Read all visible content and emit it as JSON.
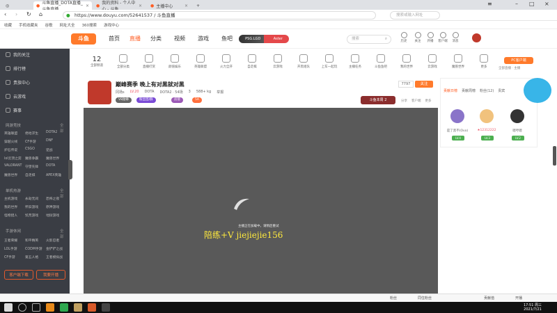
{
  "browser": {
    "tabs": [
      {
        "title": "斗鱼直播_DOTA直播_斗鱼直播",
        "active": true
      },
      {
        "title": "我的资料 - 个人中心 - 斗鱼"
      },
      {
        "title": "主播中心"
      }
    ],
    "url": "https://www.douyu.com/52641537 / 斗鱼直播",
    "url_display": "https://www.douyu.com/52641537 / 斗鱼直播",
    "search_placeholder": "搜索或输入网址",
    "bookmarks": [
      "收藏",
      "手机收藏夹",
      "谷歌",
      "网址大全",
      "360搜索",
      "游戏中心"
    ]
  },
  "header": {
    "logo": "斗鱼",
    "nav": [
      {
        "label": "首页",
        "active": false
      },
      {
        "label": "直播",
        "active": true
      },
      {
        "label": "分类",
        "active": false
      },
      {
        "label": "视频",
        "active": false
      },
      {
        "label": "游戏",
        "active": false
      },
      {
        "label": "鱼吧",
        "active": false
      }
    ],
    "promo_name": "PSG.LGD",
    "promo_vs": "Aster",
    "search_placeholder": "搜索",
    "icons": [
      {
        "label": "历史",
        "icon": "history-icon"
      },
      {
        "label": "关注",
        "icon": "follow-icon"
      },
      {
        "label": "开播",
        "icon": "broadcast-icon"
      },
      {
        "label": "客户端",
        "icon": "client-icon"
      },
      {
        "label": "消息",
        "icon": "message-icon"
      }
    ]
  },
  "sidebar": {
    "items": [
      {
        "label": "我的关注"
      },
      {
        "label": "排行榜"
      },
      {
        "label": "贵族中心"
      },
      {
        "label": "云游戏"
      },
      {
        "label": "赛事"
      }
    ],
    "sections": [
      {
        "title": "网游竞技",
        "more": "全部",
        "games": [
          "英雄联盟",
          "绝地求生",
          "DOTA2",
          "穿越火线",
          "CF手游",
          "DNF",
          "炉石传说",
          "CSGO",
          "逆战",
          "lol云顶之弈",
          "魔兽争霸",
          "魔兽世界",
          "VALORANT",
          "守望先锋",
          "DOTA",
          "魔兽世界",
          "自走棋",
          "APEX英雄"
        ]
      },
      {
        "title": "单机热游",
        "more": "全部",
        "games": [
          "主机游戏",
          "永劫无间",
          "恐怖之夜",
          "我的世界",
          "怀旧游戏",
          "原神游戏",
          "怪物猎人",
          "饥荒游戏",
          "地狱游戏"
        ]
      },
      {
        "title": "手游休闲",
        "more": "全部",
        "games": [
          "王者荣耀",
          "和平精英",
          "火影忍者",
          "LOL手游",
          "CODM手游",
          "金铲铲之战",
          "CF手游",
          "第五人格",
          "王者模拟战"
        ]
      }
    ],
    "btn_left": "客户端下载",
    "btn_right": "我要开播"
  },
  "categories": [
    {
      "label": "全部分类"
    },
    {
      "label": "直播打赏"
    },
    {
      "label": "颜值娱乐"
    },
    {
      "label": "英雄联盟"
    },
    {
      "label": "火力全开"
    },
    {
      "label": "自走棋"
    },
    {
      "label": "云游戏"
    },
    {
      "label": "开黑组队"
    },
    {
      "label": "上车一起玩"
    },
    {
      "label": "主播任务"
    },
    {
      "label": "斗鱼鱼吧"
    },
    {
      "label": "我的世界"
    },
    {
      "label": "云游戏"
    },
    {
      "label": "魔兽世界"
    },
    {
      "label": "更多"
    }
  ],
  "category_count": "12",
  "category_count_label": "全部频道",
  "client_promo": "PC客户端",
  "client_promo_sub": "全部直播  ·  主播",
  "room": {
    "title": "巅峰赛季 晚上有对黑就对黑",
    "streamer": "冈场s",
    "level": "LV.20",
    "category": "DOTA",
    "uid": "DOTA2 · 54场",
    "online": "3",
    "followers": "588+ kg",
    "report": "举报",
    "tags": [
      "V8勋章",
      "粉丝团/群",
      "房管",
      "5A"
    ],
    "rank_text": "斗鱼本周 2",
    "sub_count": "7797",
    "follow_label": "关注",
    "share": "分享",
    "client": "客户端",
    "more": "更多"
  },
  "player": {
    "message": "主播正在加载中，请稍后重试",
    "watermark": "陪练+V  jiejiejie156"
  },
  "right_panel": {
    "tabs": [
      "贡献日榜",
      "贡献周榜",
      "粉丝(12)",
      "贵宾"
    ],
    "users": [
      {
        "name": "是了黑不(Ovo)",
        "badge": "LV.4"
      },
      {
        "name": "★12312222",
        "badge": "LV.3"
      },
      {
        "name": "嗯哼嗯",
        "badge": "LV.2"
      }
    ]
  },
  "status_bar": [
    "粉丝",
    "同住粉丝",
    "贡献值",
    "开播"
  ],
  "taskbar": {
    "time": "17:51 周三",
    "date": "2021/7/21"
  }
}
